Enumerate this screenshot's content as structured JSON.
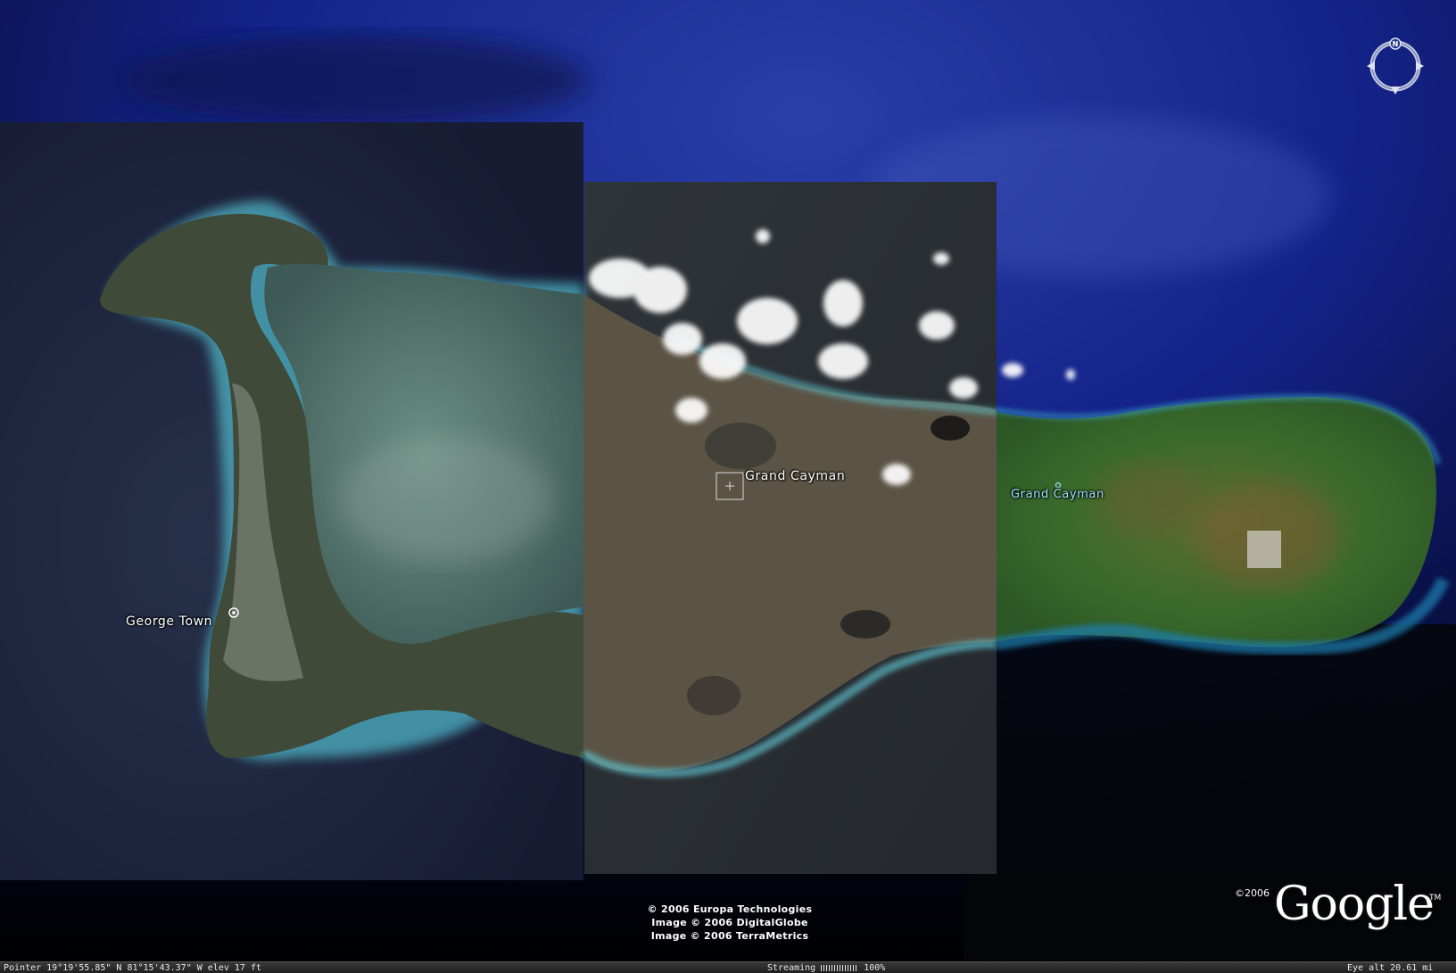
{
  "map": {
    "labels": {
      "george_town": "George Town",
      "grand_cayman_main": "Grand Cayman",
      "grand_cayman_small": "Grand Cayman"
    },
    "credits": [
      "© 2006 Europa Technologies",
      "Image © 2006 DigitalGlobe",
      "Image © 2006 TerraMetrics"
    ],
    "logo": {
      "copyright_year": "©2006",
      "wordmark": "Google",
      "trademark": "TM"
    },
    "compass": {
      "north_label": "N"
    },
    "colors": {
      "ocean_deep": "#0b1a7a",
      "ocean_dark": "#05060e",
      "shallow_water": "#6fd0de",
      "land_dark": "#3e4a35",
      "land_brown": "#5a5443",
      "land_green": "#3d6b2b"
    }
  },
  "statusbar": {
    "pointer": "Pointer 19°19'55.85\" N   81°15'43.37\" W   elev   17 ft",
    "streaming_label": "Streaming",
    "streaming_percent": "100%",
    "eye_alt": "Eye alt   20.61 mi"
  }
}
